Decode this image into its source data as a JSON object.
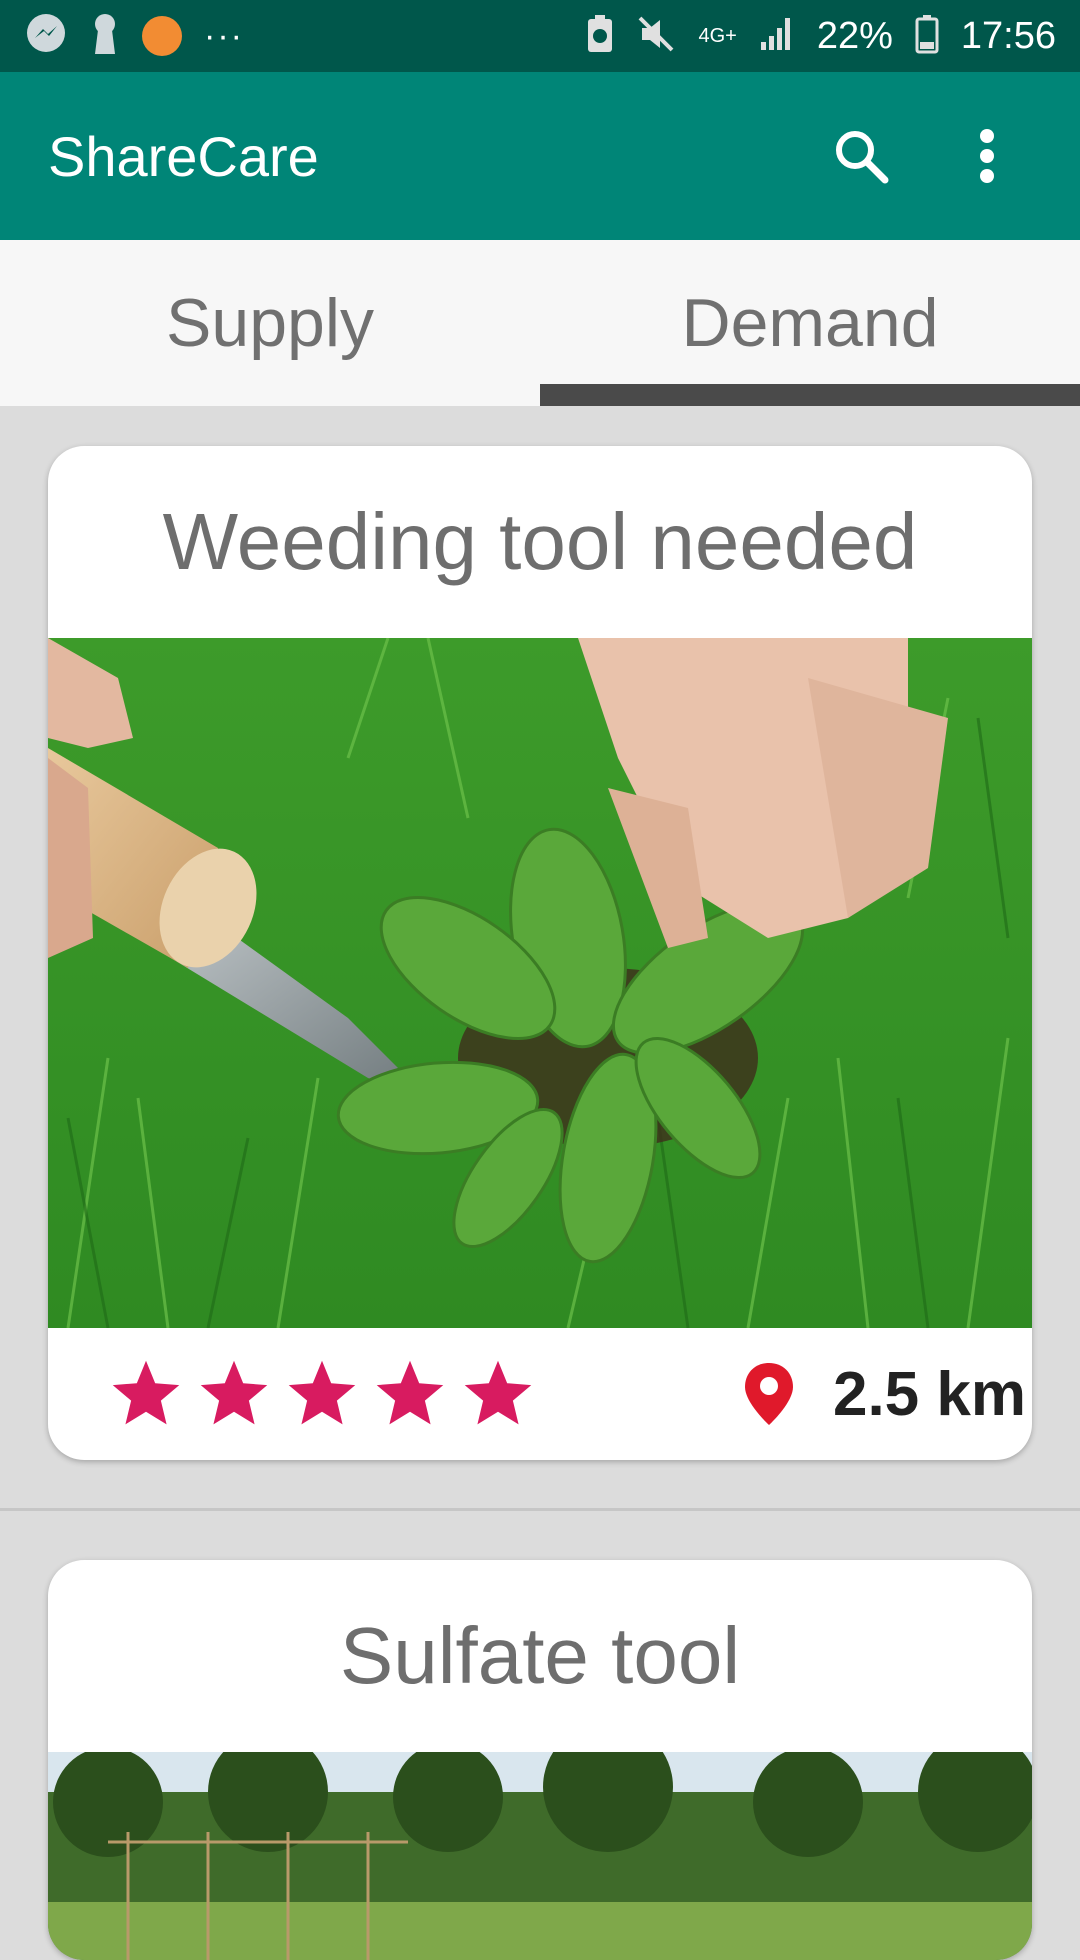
{
  "status_bar": {
    "left_icons": [
      "messenger-icon",
      "keyhole-icon",
      "orange-dot",
      "more-dots"
    ],
    "more_dots": "···",
    "network": "4G+",
    "battery": "22%",
    "time": "17:56"
  },
  "app_bar": {
    "title": "ShareCare",
    "icons": [
      "search-icon",
      "overflow-menu-icon"
    ]
  },
  "tabs": [
    {
      "label": "Supply",
      "active": false
    },
    {
      "label": "Demand",
      "active": true
    }
  ],
  "cards": [
    {
      "title": "Weeding tool needed",
      "image": "weeding-photo",
      "rating": 5,
      "rating_max": 5,
      "distance": "2.5 km"
    },
    {
      "title": "Sulfate tool",
      "image": "garden-photo"
    }
  ],
  "colors": {
    "status_bar": "#00574b",
    "app_bar": "#008577",
    "star": "#d81b60",
    "pin": "#e0192b"
  }
}
